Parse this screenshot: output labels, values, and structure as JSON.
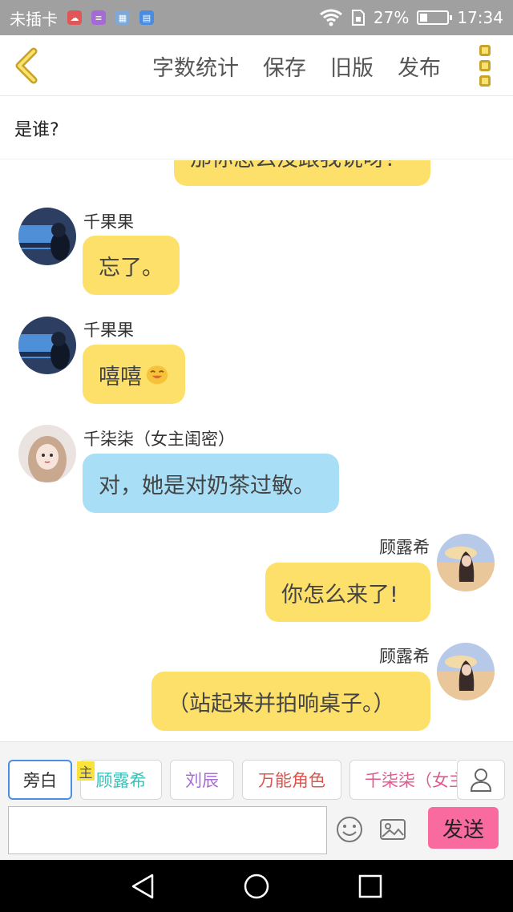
{
  "status_bar": {
    "carrier": "未插卡",
    "battery": "27%",
    "battery_level": 0.27,
    "time": "17:34"
  },
  "nav": {
    "actions": [
      "字数统计",
      "保存",
      "旧版",
      "发布"
    ]
  },
  "subtitle": "是谁?",
  "messages": {
    "partial_top": "那你怎么没跟我说呀？",
    "m1": {
      "name": "千果果",
      "text": "忘了。"
    },
    "m2": {
      "name": "千果果",
      "text": "嘻嘻"
    },
    "m3": {
      "name": "千柒柒（女主闺密）",
      "text": "对，她是对奶茶过敏。"
    },
    "m4": {
      "name": "顾露希",
      "text": "你怎么来了!"
    },
    "m5": {
      "name": "顾露希",
      "text": "（站起来并拍响桌子。）"
    }
  },
  "roles": [
    {
      "label": "旁白",
      "color": "#555555"
    },
    {
      "label": "顾露希",
      "color": "#3bbfb6"
    },
    {
      "label": "刘辰",
      "color": "#a86bd8"
    },
    {
      "label": "万能角色",
      "color": "#e2534b"
    },
    {
      "label": "千柒柒（女主闺密）",
      "color": "#e05a8d"
    }
  ],
  "role_tag": "主",
  "input": {
    "placeholder": "",
    "value": ""
  },
  "send_label": "发送",
  "colors": {
    "accent_yellow": "#fde06a",
    "bubble_blue": "#a8dff6",
    "send_pink": "#f96b9f"
  }
}
